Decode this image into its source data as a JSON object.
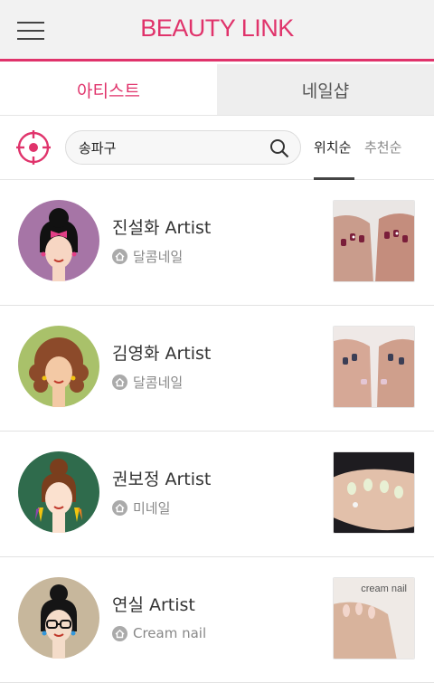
{
  "header": {
    "brand": "BEAUTY LINK",
    "accent_color": "#e0336b",
    "menu_icon": "hamburger-icon"
  },
  "tabs": [
    {
      "label": "아티스트",
      "active": true
    },
    {
      "label": "네일샵",
      "active": false
    }
  ],
  "search": {
    "value": "송파구",
    "locate_icon": "location-target-icon",
    "search_icon": "search-icon"
  },
  "sort": {
    "options": [
      {
        "label": "위치순",
        "selected": true
      },
      {
        "label": "추천순",
        "selected": false
      }
    ]
  },
  "artists": [
    {
      "name": "진설화 Artist",
      "shop": "달콤네일",
      "avatar_bg": "#a675a6",
      "thumb": "nail-photo"
    },
    {
      "name": "김영화 Artist",
      "shop": "달콤네일",
      "avatar_bg": "#a9c16a",
      "thumb": "nail-photo"
    },
    {
      "name": "권보정 Artist",
      "shop": "미네일",
      "avatar_bg": "#2f6b4c",
      "thumb": "nail-photo"
    },
    {
      "name": "연실 Artist",
      "shop": "Cream nail",
      "avatar_bg": "#c7b79c",
      "thumb": "nail-photo",
      "thumb_text": "cream nail"
    }
  ]
}
